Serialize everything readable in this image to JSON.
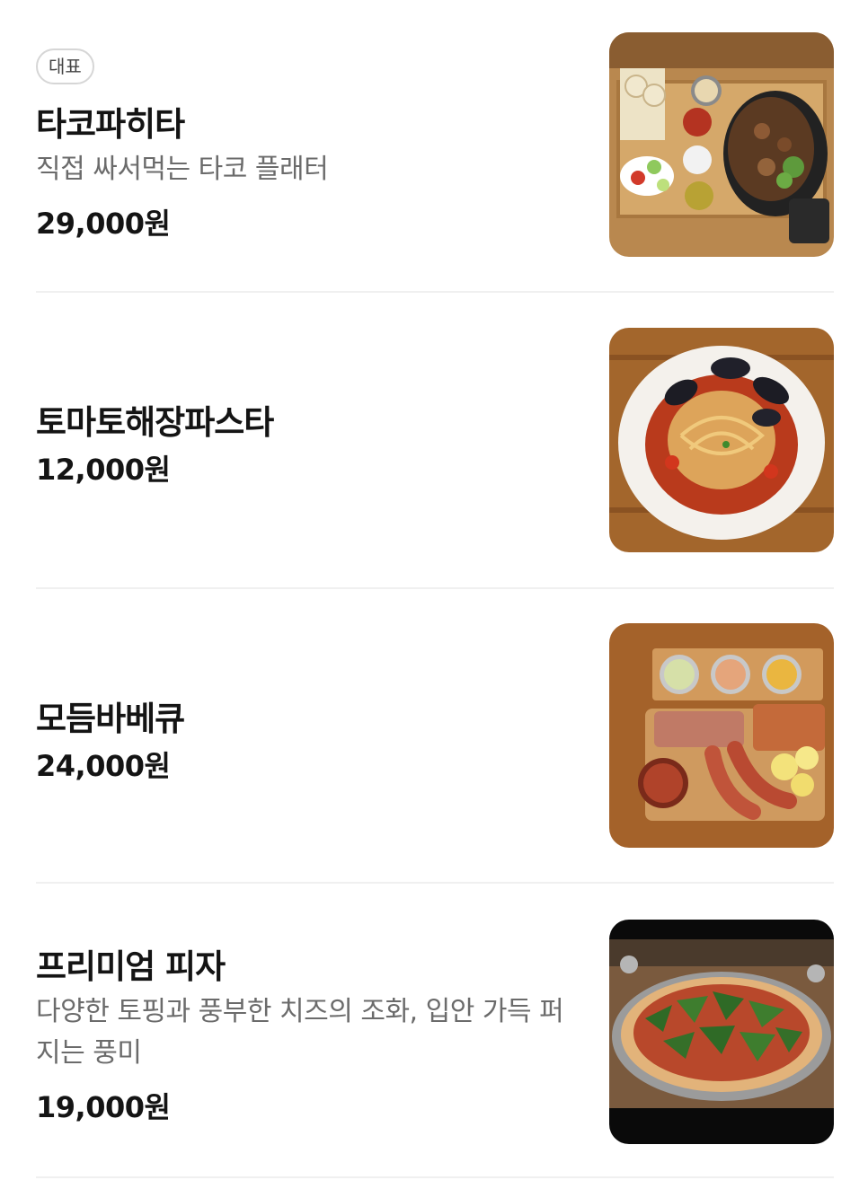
{
  "menu": {
    "items": [
      {
        "badge": "대표",
        "name": "타코파히타",
        "description": "직접 싸서먹는 타코 플래터",
        "price": "29,000원",
        "image_icon": "taco-platter-photo"
      },
      {
        "name": "토마토해장파스타",
        "price": "12,000원",
        "image_icon": "tomato-pasta-photo"
      },
      {
        "name": "모듬바베큐",
        "price": "24,000원",
        "image_icon": "bbq-platter-photo"
      },
      {
        "name": "프리미엄 피자",
        "description": "다양한 토핑과 풍부한 치즈의 조화, 입안 가득 퍼지는 풍미",
        "price": "19,000원",
        "image_icon": "pizza-photo"
      }
    ]
  }
}
